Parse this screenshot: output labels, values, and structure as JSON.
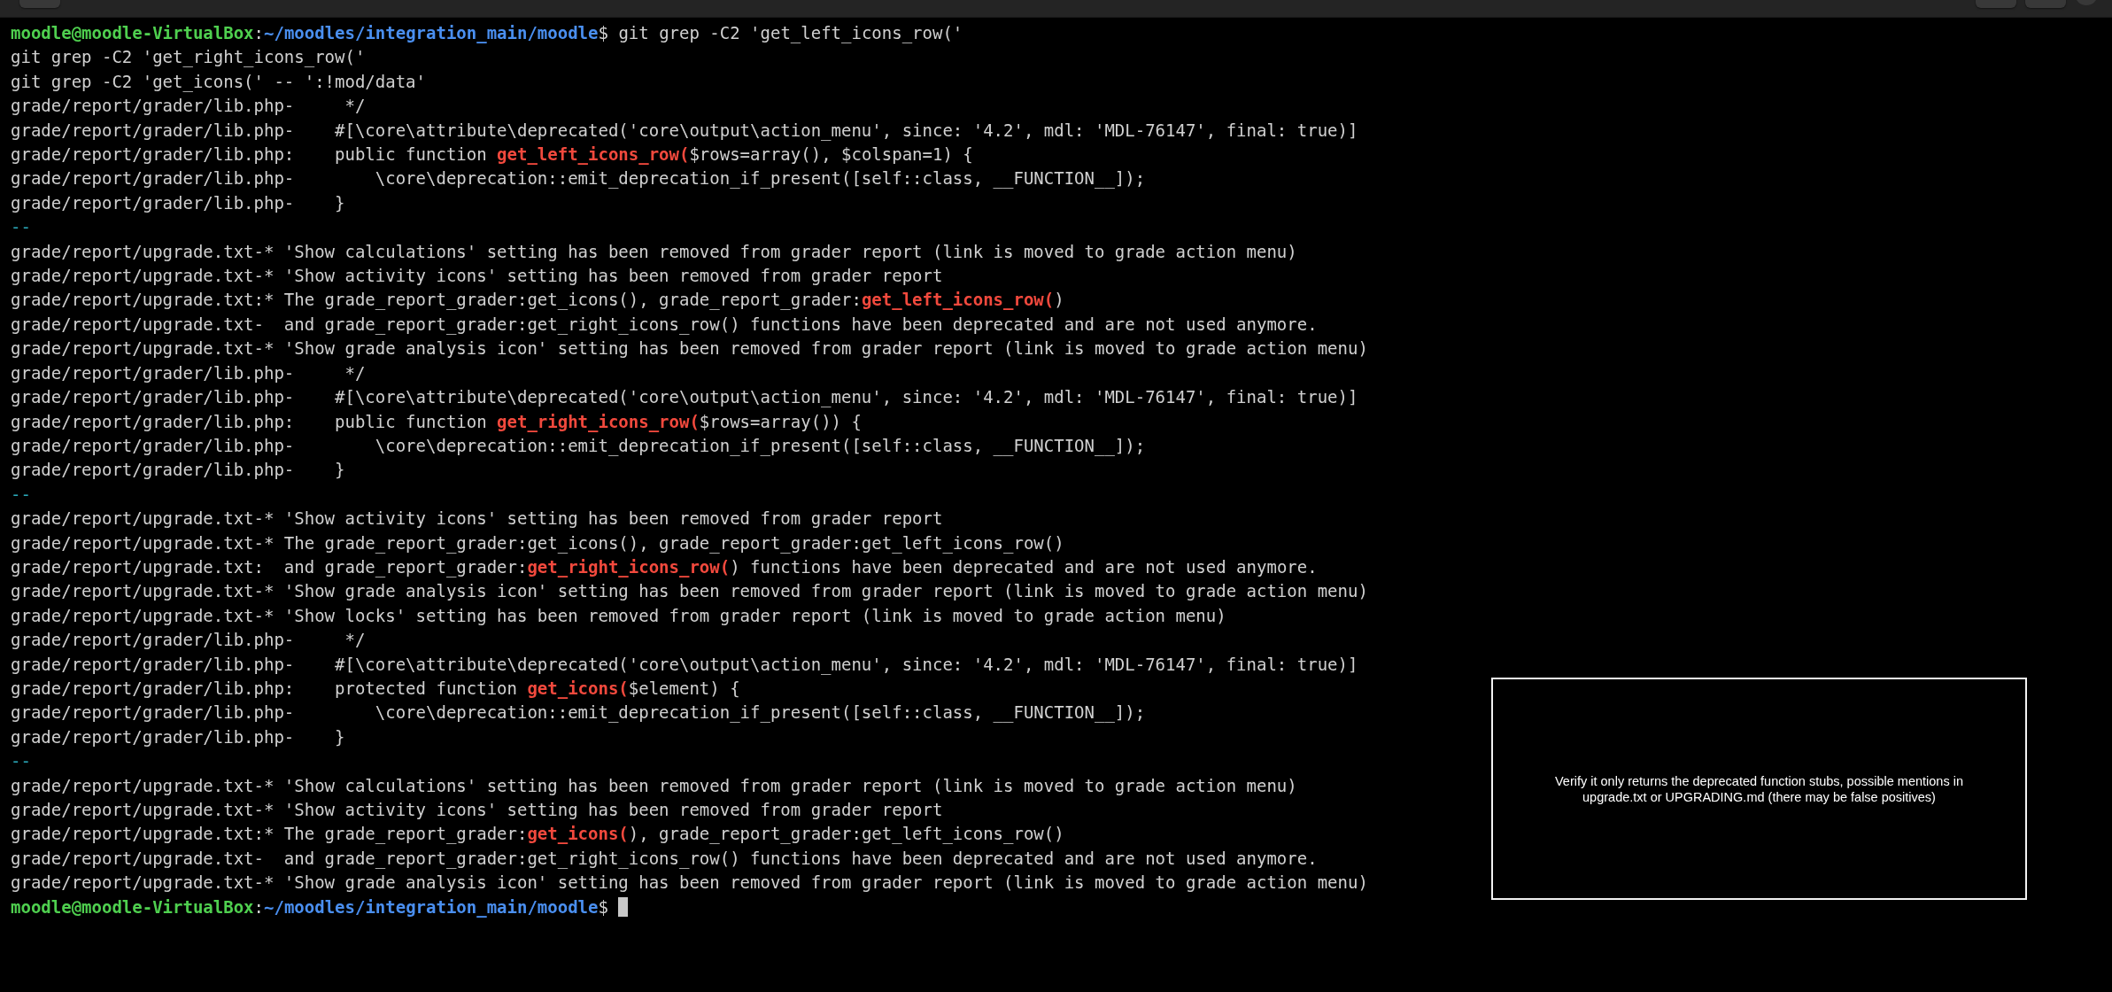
{
  "terminal": {
    "lines": [
      {
        "segments": [
          {
            "kind": "user",
            "text": "moodle@moodle-VirtualBox"
          },
          {
            "kind": "plain",
            "text": ":"
          },
          {
            "kind": "path",
            "text": "~/moodles/integration_main/moodle"
          },
          {
            "kind": "plain",
            "text": "$ git grep -C2 'get_left_icons_row('"
          }
        ]
      },
      {
        "segments": [
          {
            "kind": "plain",
            "text": "git grep -C2 'get_right_icons_row('"
          }
        ]
      },
      {
        "segments": [
          {
            "kind": "plain",
            "text": "git grep -C2 'get_icons(' -- ':!mod/data'"
          }
        ]
      },
      {
        "segments": [
          {
            "kind": "plain",
            "text": "grade/report/grader/lib.php-     */"
          }
        ]
      },
      {
        "segments": [
          {
            "kind": "plain",
            "text": "grade/report/grader/lib.php-    #[\\core\\attribute\\deprecated('core\\output\\action_menu', since: '4.2', mdl: 'MDL-76147', final: true)]"
          }
        ]
      },
      {
        "segments": [
          {
            "kind": "plain",
            "text": "grade/report/grader/lib.php:    public function "
          },
          {
            "kind": "match",
            "text": "get_left_icons_row("
          },
          {
            "kind": "plain",
            "text": "$rows=array(), $colspan=1) {"
          }
        ]
      },
      {
        "segments": [
          {
            "kind": "plain",
            "text": "grade/report/grader/lib.php-        \\core\\deprecation::emit_deprecation_if_present([self::class, __FUNCTION__]);"
          }
        ]
      },
      {
        "segments": [
          {
            "kind": "plain",
            "text": "grade/report/grader/lib.php-    }"
          }
        ]
      },
      {
        "segments": [
          {
            "kind": "separator",
            "text": "--"
          }
        ]
      },
      {
        "segments": [
          {
            "kind": "plain",
            "text": "grade/report/upgrade.txt-* 'Show calculations' setting has been removed from grader report (link is moved to grade action menu)"
          }
        ]
      },
      {
        "segments": [
          {
            "kind": "plain",
            "text": "grade/report/upgrade.txt-* 'Show activity icons' setting has been removed from grader report"
          }
        ]
      },
      {
        "segments": [
          {
            "kind": "plain",
            "text": "grade/report/upgrade.txt:* The grade_report_grader:get_icons(), grade_report_grader:"
          },
          {
            "kind": "match",
            "text": "get_left_icons_row("
          },
          {
            "kind": "plain",
            "text": ")"
          }
        ]
      },
      {
        "segments": [
          {
            "kind": "plain",
            "text": "grade/report/upgrade.txt-  and grade_report_grader:get_right_icons_row() functions have been deprecated and are not used anymore."
          }
        ]
      },
      {
        "segments": [
          {
            "kind": "plain",
            "text": "grade/report/upgrade.txt-* 'Show grade analysis icon' setting has been removed from grader report (link is moved to grade action menu)"
          }
        ]
      },
      {
        "segments": [
          {
            "kind": "plain",
            "text": "grade/report/grader/lib.php-     */"
          }
        ]
      },
      {
        "segments": [
          {
            "kind": "plain",
            "text": "grade/report/grader/lib.php-    #[\\core\\attribute\\deprecated('core\\output\\action_menu', since: '4.2', mdl: 'MDL-76147', final: true)]"
          }
        ]
      },
      {
        "segments": [
          {
            "kind": "plain",
            "text": "grade/report/grader/lib.php:    public function "
          },
          {
            "kind": "match",
            "text": "get_right_icons_row("
          },
          {
            "kind": "plain",
            "text": "$rows=array()) {"
          }
        ]
      },
      {
        "segments": [
          {
            "kind": "plain",
            "text": "grade/report/grader/lib.php-        \\core\\deprecation::emit_deprecation_if_present([self::class, __FUNCTION__]);"
          }
        ]
      },
      {
        "segments": [
          {
            "kind": "plain",
            "text": "grade/report/grader/lib.php-    }"
          }
        ]
      },
      {
        "segments": [
          {
            "kind": "separator",
            "text": "--"
          }
        ]
      },
      {
        "segments": [
          {
            "kind": "plain",
            "text": "grade/report/upgrade.txt-* 'Show activity icons' setting has been removed from grader report"
          }
        ]
      },
      {
        "segments": [
          {
            "kind": "plain",
            "text": "grade/report/upgrade.txt-* The grade_report_grader:get_icons(), grade_report_grader:get_left_icons_row()"
          }
        ]
      },
      {
        "segments": [
          {
            "kind": "plain",
            "text": "grade/report/upgrade.txt:  and grade_report_grader:"
          },
          {
            "kind": "match",
            "text": "get_right_icons_row("
          },
          {
            "kind": "plain",
            "text": ") functions have been deprecated and are not used anymore."
          }
        ]
      },
      {
        "segments": [
          {
            "kind": "plain",
            "text": "grade/report/upgrade.txt-* 'Show grade analysis icon' setting has been removed from grader report (link is moved to grade action menu)"
          }
        ]
      },
      {
        "segments": [
          {
            "kind": "plain",
            "text": "grade/report/upgrade.txt-* 'Show locks' setting has been removed from grader report (link is moved to grade action menu)"
          }
        ]
      },
      {
        "segments": [
          {
            "kind": "plain",
            "text": "grade/report/grader/lib.php-     */"
          }
        ]
      },
      {
        "segments": [
          {
            "kind": "plain",
            "text": "grade/report/grader/lib.php-    #[\\core\\attribute\\deprecated('core\\output\\action_menu', since: '4.2', mdl: 'MDL-76147', final: true)]"
          }
        ]
      },
      {
        "segments": [
          {
            "kind": "plain",
            "text": "grade/report/grader/lib.php:    protected function "
          },
          {
            "kind": "match",
            "text": "get_icons("
          },
          {
            "kind": "plain",
            "text": "$element) {"
          }
        ]
      },
      {
        "segments": [
          {
            "kind": "plain",
            "text": "grade/report/grader/lib.php-        \\core\\deprecation::emit_deprecation_if_present([self::class, __FUNCTION__]);"
          }
        ]
      },
      {
        "segments": [
          {
            "kind": "plain",
            "text": "grade/report/grader/lib.php-    }"
          }
        ]
      },
      {
        "segments": [
          {
            "kind": "separator",
            "text": "--"
          }
        ]
      },
      {
        "segments": [
          {
            "kind": "plain",
            "text": "grade/report/upgrade.txt-* 'Show calculations' setting has been removed from grader report (link is moved to grade action menu)"
          }
        ]
      },
      {
        "segments": [
          {
            "kind": "plain",
            "text": "grade/report/upgrade.txt-* 'Show activity icons' setting has been removed from grader report"
          }
        ]
      },
      {
        "segments": [
          {
            "kind": "plain",
            "text": "grade/report/upgrade.txt:* The grade_report_grader:"
          },
          {
            "kind": "match",
            "text": "get_icons("
          },
          {
            "kind": "plain",
            "text": "), grade_report_grader:get_left_icons_row()"
          }
        ]
      },
      {
        "segments": [
          {
            "kind": "plain",
            "text": "grade/report/upgrade.txt-  and grade_report_grader:get_right_icons_row() functions have been deprecated and are not used anymore."
          }
        ]
      },
      {
        "segments": [
          {
            "kind": "plain",
            "text": "grade/report/upgrade.txt-* 'Show grade analysis icon' setting has been removed from grader report (link is moved to grade action menu)"
          }
        ]
      },
      {
        "segments": [
          {
            "kind": "user",
            "text": "moodle@moodle-VirtualBox"
          },
          {
            "kind": "plain",
            "text": ":"
          },
          {
            "kind": "path",
            "text": "~/moodles/integration_main/moodle"
          },
          {
            "kind": "plain",
            "text": "$ "
          }
        ],
        "cursor": true
      }
    ]
  },
  "overlay": {
    "text": "Verify it only returns the deprecated function stubs, possible mentions in upgrade.txt or UPGRADING.md (there may be false positives)"
  }
}
